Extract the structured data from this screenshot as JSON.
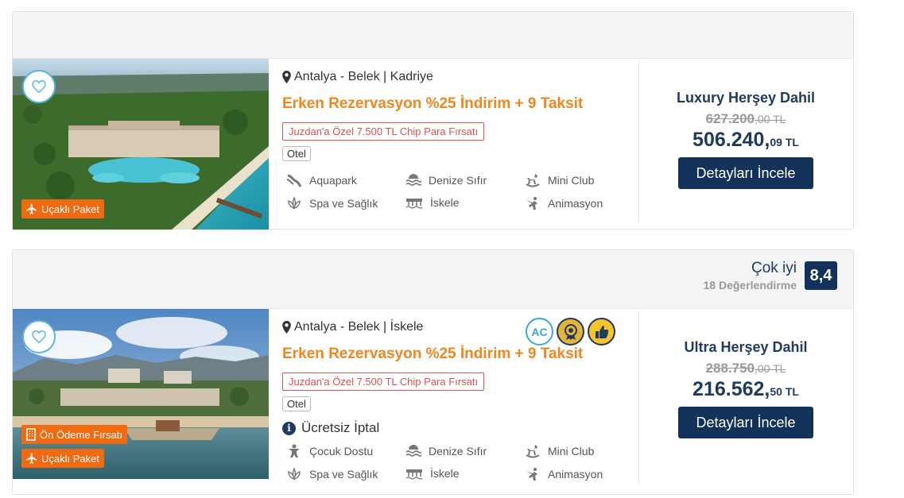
{
  "hotels": [
    {
      "location": "Antalya - Belek | Kadriye",
      "promo": "Erken Rezervasyon %25 İndirim + 9 Taksit",
      "chip": "Juzdan'a Özel 7.500 TL Chip Para Fırsatı",
      "type": "Otel",
      "badges": [
        "Uçaklı Paket"
      ],
      "features": [
        "Aquapark",
        "Denize Sıfır",
        "Mini Club",
        "Spa ve Sağlık",
        "İskele",
        "Animasyon"
      ],
      "board": "Luxury Herşey Dahil",
      "old_price": "627.200",
      "old_price_cents": ",00 TL",
      "new_price": "506.240,",
      "new_price_cents": "09 TL",
      "button": "Detayları İncele"
    },
    {
      "location": "Antalya - Belek | İskele",
      "promo": "Erken Rezervasyon %25 İndirim + 9 Taksit",
      "chip": "Juzdan'a Özel 7.500 TL Chip Para Fırsatı",
      "type": "Otel",
      "cancel": "Ücretsiz İptal",
      "badges": [
        "Ön Ödeme Fırsatı",
        "Uçaklı Paket"
      ],
      "awards": [
        "AC",
        "medal-icon",
        "thumbs-up-icon"
      ],
      "features": [
        "Çocuk Dostu",
        "Denize Sıfır",
        "Mini Club",
        "Spa ve Sağlık",
        "İskele",
        "Animasyon"
      ],
      "board": "Ultra Herşey Dahil",
      "old_price": "288.750",
      "old_price_cents": ",00 TL",
      "new_price": "216.562,",
      "new_price_cents": "50 TL",
      "button": "Detayları İncele",
      "rating_label": "Çok iyi",
      "rating_count": "18 Değerlendirme",
      "rating_score": "8,4"
    }
  ],
  "colors": {
    "navy": "#13325a",
    "orange": "#f0861e",
    "badge_orange": "#ef6a11",
    "chip_red": "#d9534f"
  }
}
